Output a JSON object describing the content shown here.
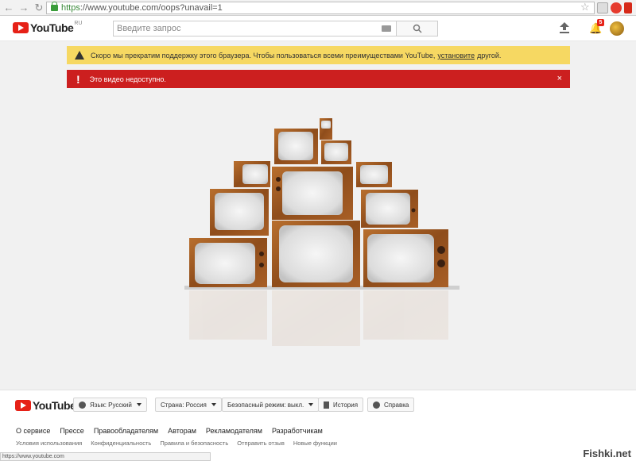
{
  "browser": {
    "url_scheme": "https",
    "url_rest": "://www.youtube.com/oops?unavail=1",
    "status_url": "https://www.youtube.com"
  },
  "header": {
    "logo_text": "YouTube",
    "logo_region": "RU",
    "search_placeholder": "Введите запрос",
    "notification_count": "5"
  },
  "banners": {
    "warning_text_before": "Скоро мы прекратим поддержку этого браузера. Чтобы пользоваться всеми преимуществами YouTube,",
    "warning_link": "установите",
    "warning_text_after": "другой.",
    "error_text": "Это видео недоступно.",
    "error_close": "×"
  },
  "footer": {
    "logo_text": "YouTube",
    "language_btn": "Язык: Русский",
    "country_btn": "Страна: Россия",
    "safety_btn": "Безопасный режим: выкл.",
    "history_btn": "История",
    "help_btn": "Справка",
    "links_primary": [
      "О сервисе",
      "Прессе",
      "Правообладателям",
      "Авторам",
      "Рекламодателям",
      "Разработчикам"
    ],
    "links_secondary": [
      "Условия использования",
      "Конфиденциальность",
      "Правила и безопасность",
      "Отправить отзыв",
      "Новые функции"
    ]
  },
  "watermark": "Fishki.net",
  "colors": {
    "brand_red": "#e62117",
    "warning_bg": "#f6d862",
    "error_bg": "#cc1f1f"
  }
}
